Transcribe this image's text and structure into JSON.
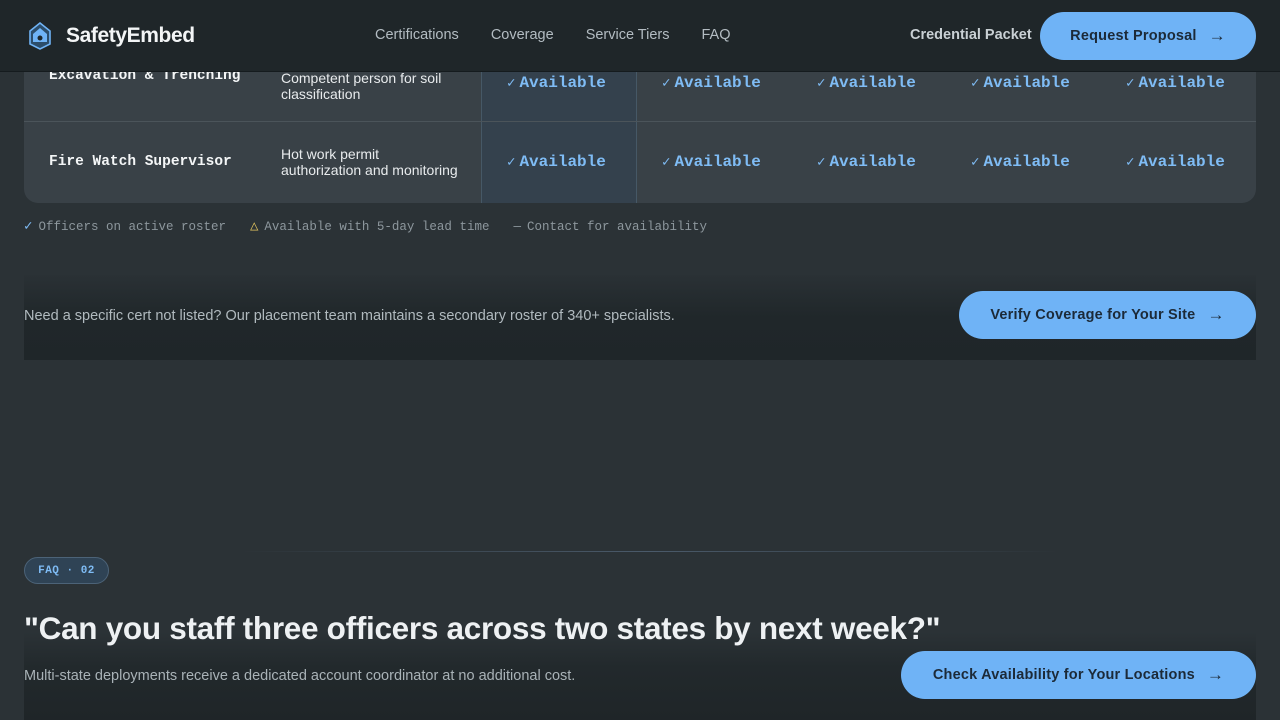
{
  "header": {
    "brand": "SafetyEmbed",
    "nav": [
      "Certifications",
      "Coverage",
      "Service Tiers",
      "FAQ"
    ],
    "credential_link": "Credential Packet",
    "cta": "Request Proposal",
    "cta_icon": "arrow-right-icon",
    "logo_icon": "shield-house-icon"
  },
  "table": {
    "rows": [
      {
        "cert": "Excavation & Trenching",
        "desc": "Competent person for soil classification",
        "availability": [
          "Available",
          "Available",
          "Available",
          "Available",
          "Available"
        ]
      },
      {
        "cert": "Fire Watch Supervisor",
        "desc": "Hot work permit authorization and monitoring",
        "availability": [
          "Available",
          "Available",
          "Available",
          "Available",
          "Available"
        ]
      }
    ],
    "check_glyph": "✓"
  },
  "legend": [
    {
      "icon": "check-icon",
      "glyph": "✓",
      "label": "Officers on active roster"
    },
    {
      "icon": "warning-triangle-icon",
      "glyph": "△",
      "label": "Available with 5-day lead time"
    },
    {
      "icon": "dash-icon",
      "glyph": "—",
      "label": "Contact for availability"
    }
  ],
  "cta_band": {
    "text": "Need a specific cert not listed? Our placement team maintains a secondary roster of 340+ specialists.",
    "button": "Verify Coverage for Your Site"
  },
  "faq": {
    "pill": "FAQ · 02",
    "question": "\"Can you staff three officers across two states by next week?\"",
    "answer": "Multi-state deployments receive a dedicated account coordinator at no additional cost.",
    "button": "Check Availability for Your Locations"
  },
  "colors": {
    "accent": "#6fb3f6",
    "available_text": "#7fbcf5",
    "warning": "#e0c25e",
    "background": "#2b3236"
  },
  "arrow": "→"
}
